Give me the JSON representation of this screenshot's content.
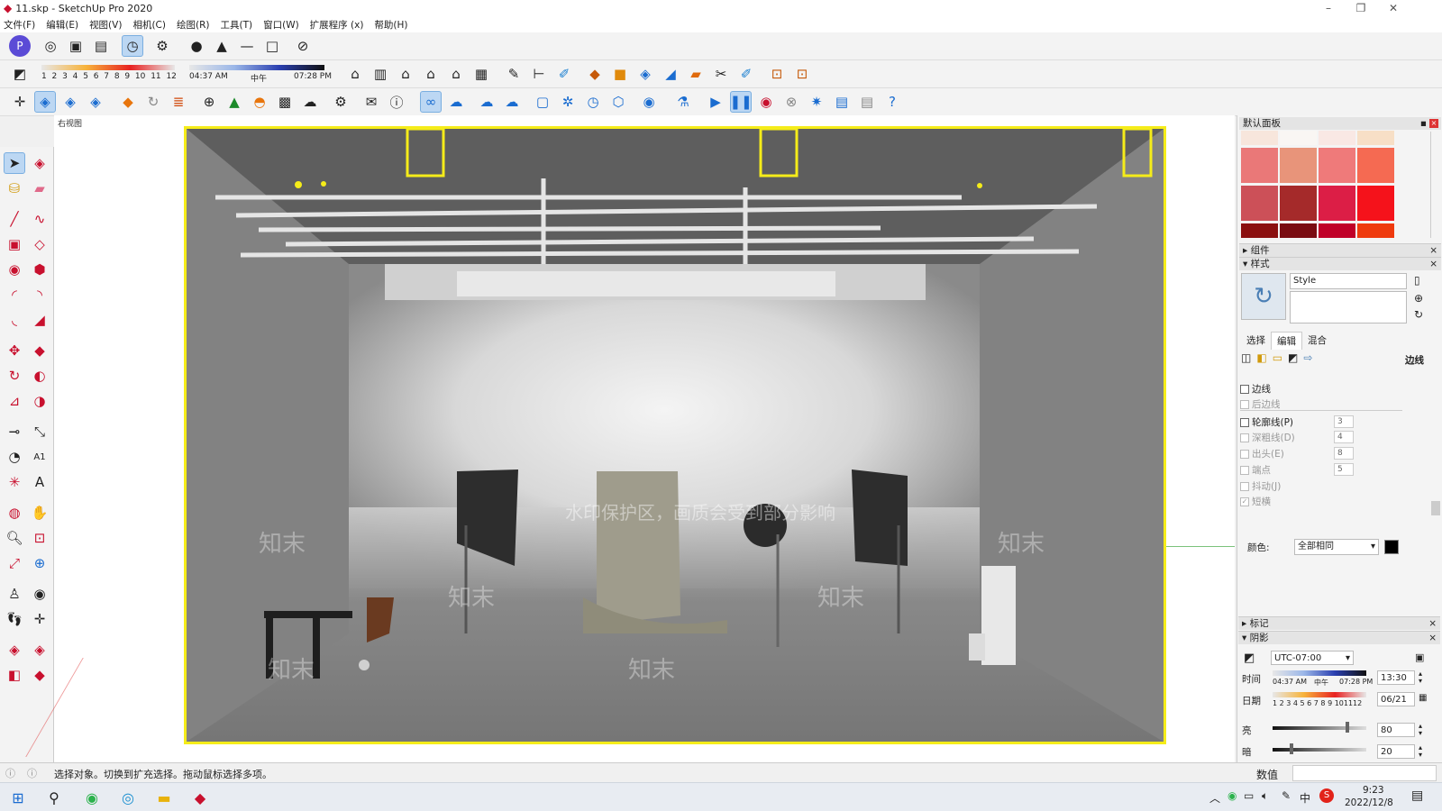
{
  "window": {
    "title": "11.skp - SketchUp Pro 2020",
    "minimize": "–",
    "restore": "❐",
    "close": "✕"
  },
  "menu": [
    "文件(F)",
    "编辑(E)",
    "视图(V)",
    "相机(C)",
    "绘图(R)",
    "工具(T)",
    "窗口(W)",
    "扩展程序 (x)",
    "帮助(H)"
  ],
  "shadow_toolbar": {
    "months": [
      "1",
      "2",
      "3",
      "4",
      "5",
      "6",
      "7",
      "8",
      "9",
      "10",
      "11",
      "12"
    ],
    "time_start": "04:37 AM",
    "time_mid": "中午",
    "time_end": "07:28 PM"
  },
  "viewport": {
    "scene_tab": "右视图",
    "watermark_main": "水印保护区，画质会受到部分影响",
    "watermark_brand": "知末"
  },
  "tray": {
    "header": "默认面板",
    "swatch_colors": [
      "#f7e6dc",
      "#f9f6f3",
      "#f9e8e4",
      "#f7dfc6",
      "#ea7878",
      "#e8947a",
      "#ef7a7a",
      "#f56a52",
      "#cc5058",
      "#a52a2a",
      "#dc1e46",
      "#f5121b",
      "#8b1010",
      "#7a0c12",
      "#c00028",
      "#ef3a0e"
    ],
    "sections": {
      "components": "组件",
      "styles": "样式",
      "tags": "标记",
      "shadows": "阴影"
    },
    "style_name": "Style",
    "style_tabs": [
      "选择",
      "编辑",
      "混合"
    ],
    "edge_label": "边线",
    "edge_options": [
      {
        "label": "边线",
        "checked": false,
        "enabled": true,
        "value": ""
      },
      {
        "label": "后边线",
        "checked": false,
        "enabled": false,
        "value": ""
      },
      {
        "label": "轮廓线(P)",
        "checked": false,
        "enabled": true,
        "value": "3"
      },
      {
        "label": "深粗线(D)",
        "checked": false,
        "enabled": false,
        "value": "4"
      },
      {
        "label": "出头(E)",
        "checked": false,
        "enabled": false,
        "value": "8"
      },
      {
        "label": "端点",
        "checked": false,
        "enabled": false,
        "value": "5"
      },
      {
        "label": "抖动(J)",
        "checked": false,
        "enabled": false,
        "value": ""
      },
      {
        "label": "短横",
        "checked": true,
        "enabled": false,
        "value": ""
      }
    ],
    "color_label": "颜色:",
    "color_select": "全部相同",
    "shadow": {
      "timezone": "UTC-07:00",
      "time_label": "时间",
      "time_start": "04:37 AM",
      "time_mid": "中午",
      "time_end": "07:28 PM",
      "time_value": "13:30",
      "date_label": "日期",
      "date_months": "1 2 3 4 5 6 7 8 9 101112",
      "date_value": "06/21",
      "light_label": "亮",
      "light_value": "80",
      "light_fraction": 0.8,
      "dark_label": "暗",
      "dark_value": "20",
      "dark_fraction": 0.2
    }
  },
  "status": {
    "text": "选择对象。切换到扩充选择。拖动鼠标选择多项。",
    "measure_label": "数值"
  },
  "taskbar": {
    "time": "9:23",
    "date": "2022/12/8",
    "ime": "中"
  }
}
